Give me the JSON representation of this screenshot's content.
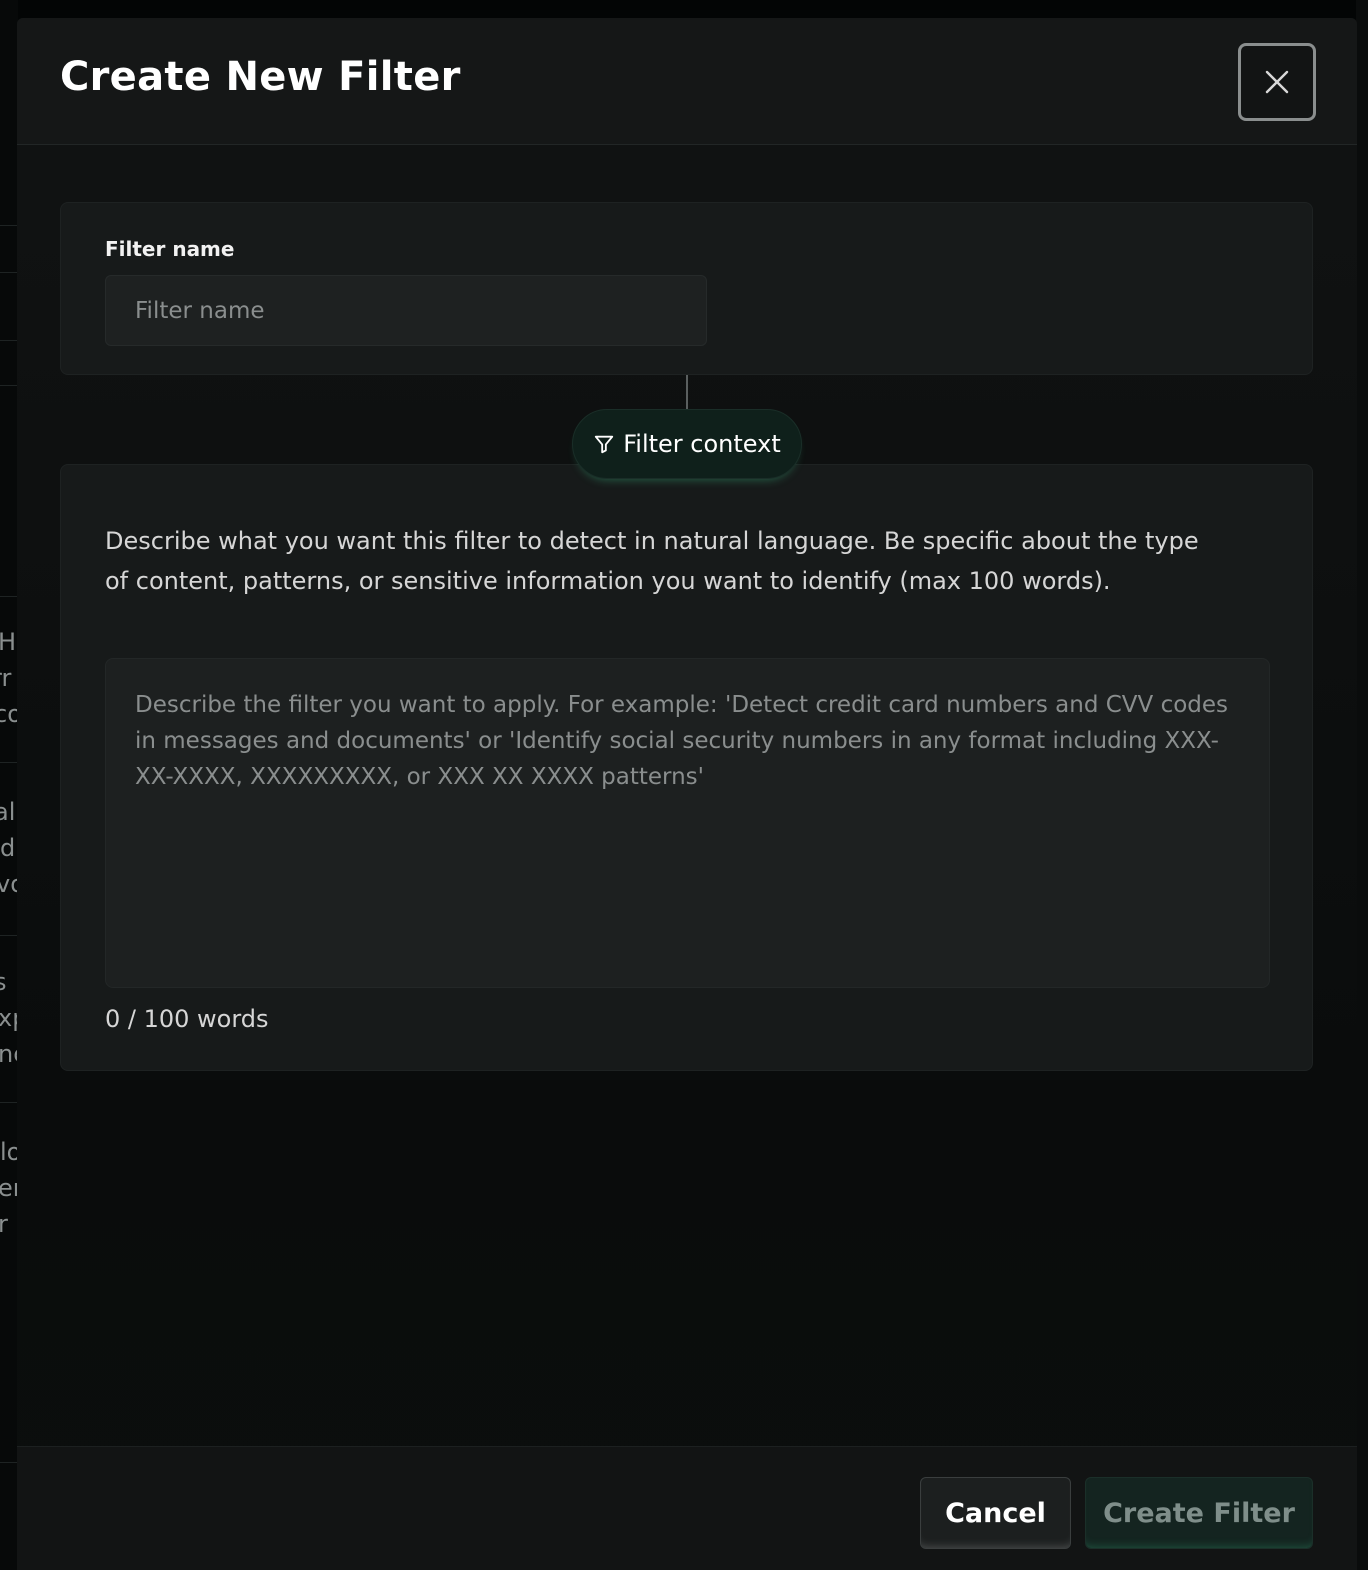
{
  "modal": {
    "title": "Create New Filter",
    "close_icon": "close-icon"
  },
  "filter_name": {
    "label": "Filter name",
    "value": "",
    "placeholder": "Filter name"
  },
  "filter_context": {
    "pill_label": "Filter context",
    "pill_icon": "funnel-icon",
    "description": "Describe what you want this filter to detect in natural language. Be specific about the type of content, patterns, or sensitive information you want to identify (max 100 words).",
    "value": "",
    "placeholder": "Describe the filter you want to apply. For example: 'Detect credit card numbers and CVV codes in messages and documents' or 'Identify social security numbers in any format including XXX-XX-XXXX, XXXXXXXXX, or XXX XX XXXX patterns'",
    "word_count": "0 / 100 words"
  },
  "footer": {
    "cancel_label": "Cancel",
    "create_label": "Create Filter"
  },
  "background_fragments": [
    "He",
    "rr",
    "co",
    "al",
    "d",
    "vo",
    "s",
    "xp",
    "nc",
    "lo",
    "er",
    "r"
  ],
  "colors": {
    "accent": "#1b3a30",
    "modal_bg": "#111313",
    "card_bg": "#171a1a"
  }
}
